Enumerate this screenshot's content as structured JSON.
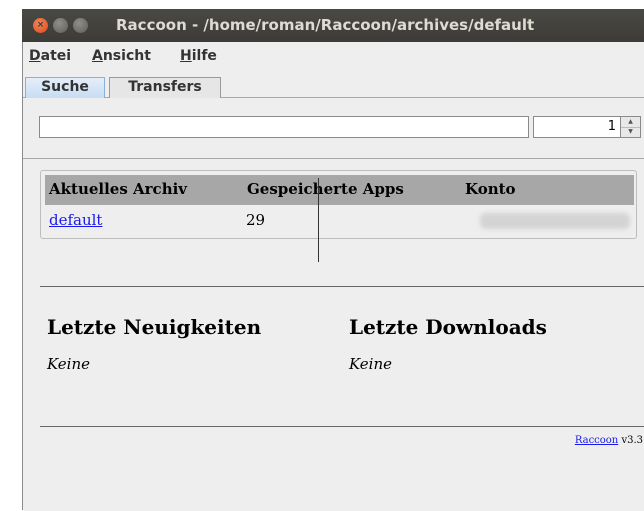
{
  "window": {
    "title": "Raccoon - /home/roman/Raccoon/archives/default",
    "close_glyph": "×"
  },
  "menubar": {
    "items": [
      {
        "label": "Datei",
        "mnemonic": "D",
        "rest": "atei"
      },
      {
        "label": "Ansicht",
        "mnemonic": "A",
        "rest": "nsicht"
      },
      {
        "label": "Hilfe",
        "mnemonic": "H",
        "rest": "ilfe"
      }
    ]
  },
  "tabs": [
    {
      "label": "Suche",
      "active": true
    },
    {
      "label": "Transfers",
      "active": false
    }
  ],
  "search": {
    "query": "",
    "page_value": "1"
  },
  "archive_table": {
    "headers": [
      "Aktuelles Archiv",
      "Gespeicherte Apps",
      "Konto"
    ],
    "row": {
      "archive": "default",
      "apps": "29",
      "account": ""
    }
  },
  "sections": {
    "news": {
      "title": "Letzte Neuigkeiten",
      "body": "Keine"
    },
    "downloads": {
      "title": "Letzte Downloads",
      "body": "Keine"
    }
  },
  "footer": {
    "app_link": "Raccoon",
    "version": "v3.3"
  },
  "colors": {
    "titlebar": "#3c3b37",
    "close_button": "#df4a16",
    "link": "#1a1aee",
    "table_header": "#a7a7a7"
  }
}
